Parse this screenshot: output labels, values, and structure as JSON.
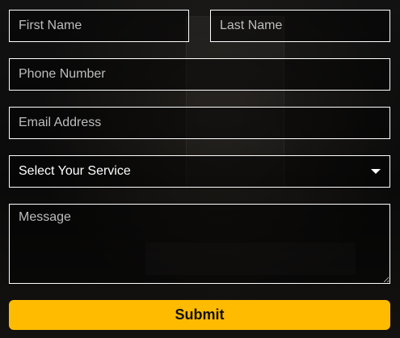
{
  "form": {
    "first_name": {
      "placeholder": "First Name",
      "value": ""
    },
    "last_name": {
      "placeholder": "Last Name",
      "value": ""
    },
    "phone": {
      "placeholder": "Phone Number",
      "value": ""
    },
    "email": {
      "placeholder": "Email Address",
      "value": ""
    },
    "service": {
      "selected": "Select Your Service",
      "icon": "caret-down-icon"
    },
    "message": {
      "placeholder": "Message",
      "value": ""
    },
    "submit_label": "Submit"
  },
  "colors": {
    "accent": "#ffbb00",
    "field_border": "#ffffff",
    "background": "#0b0b0b"
  }
}
